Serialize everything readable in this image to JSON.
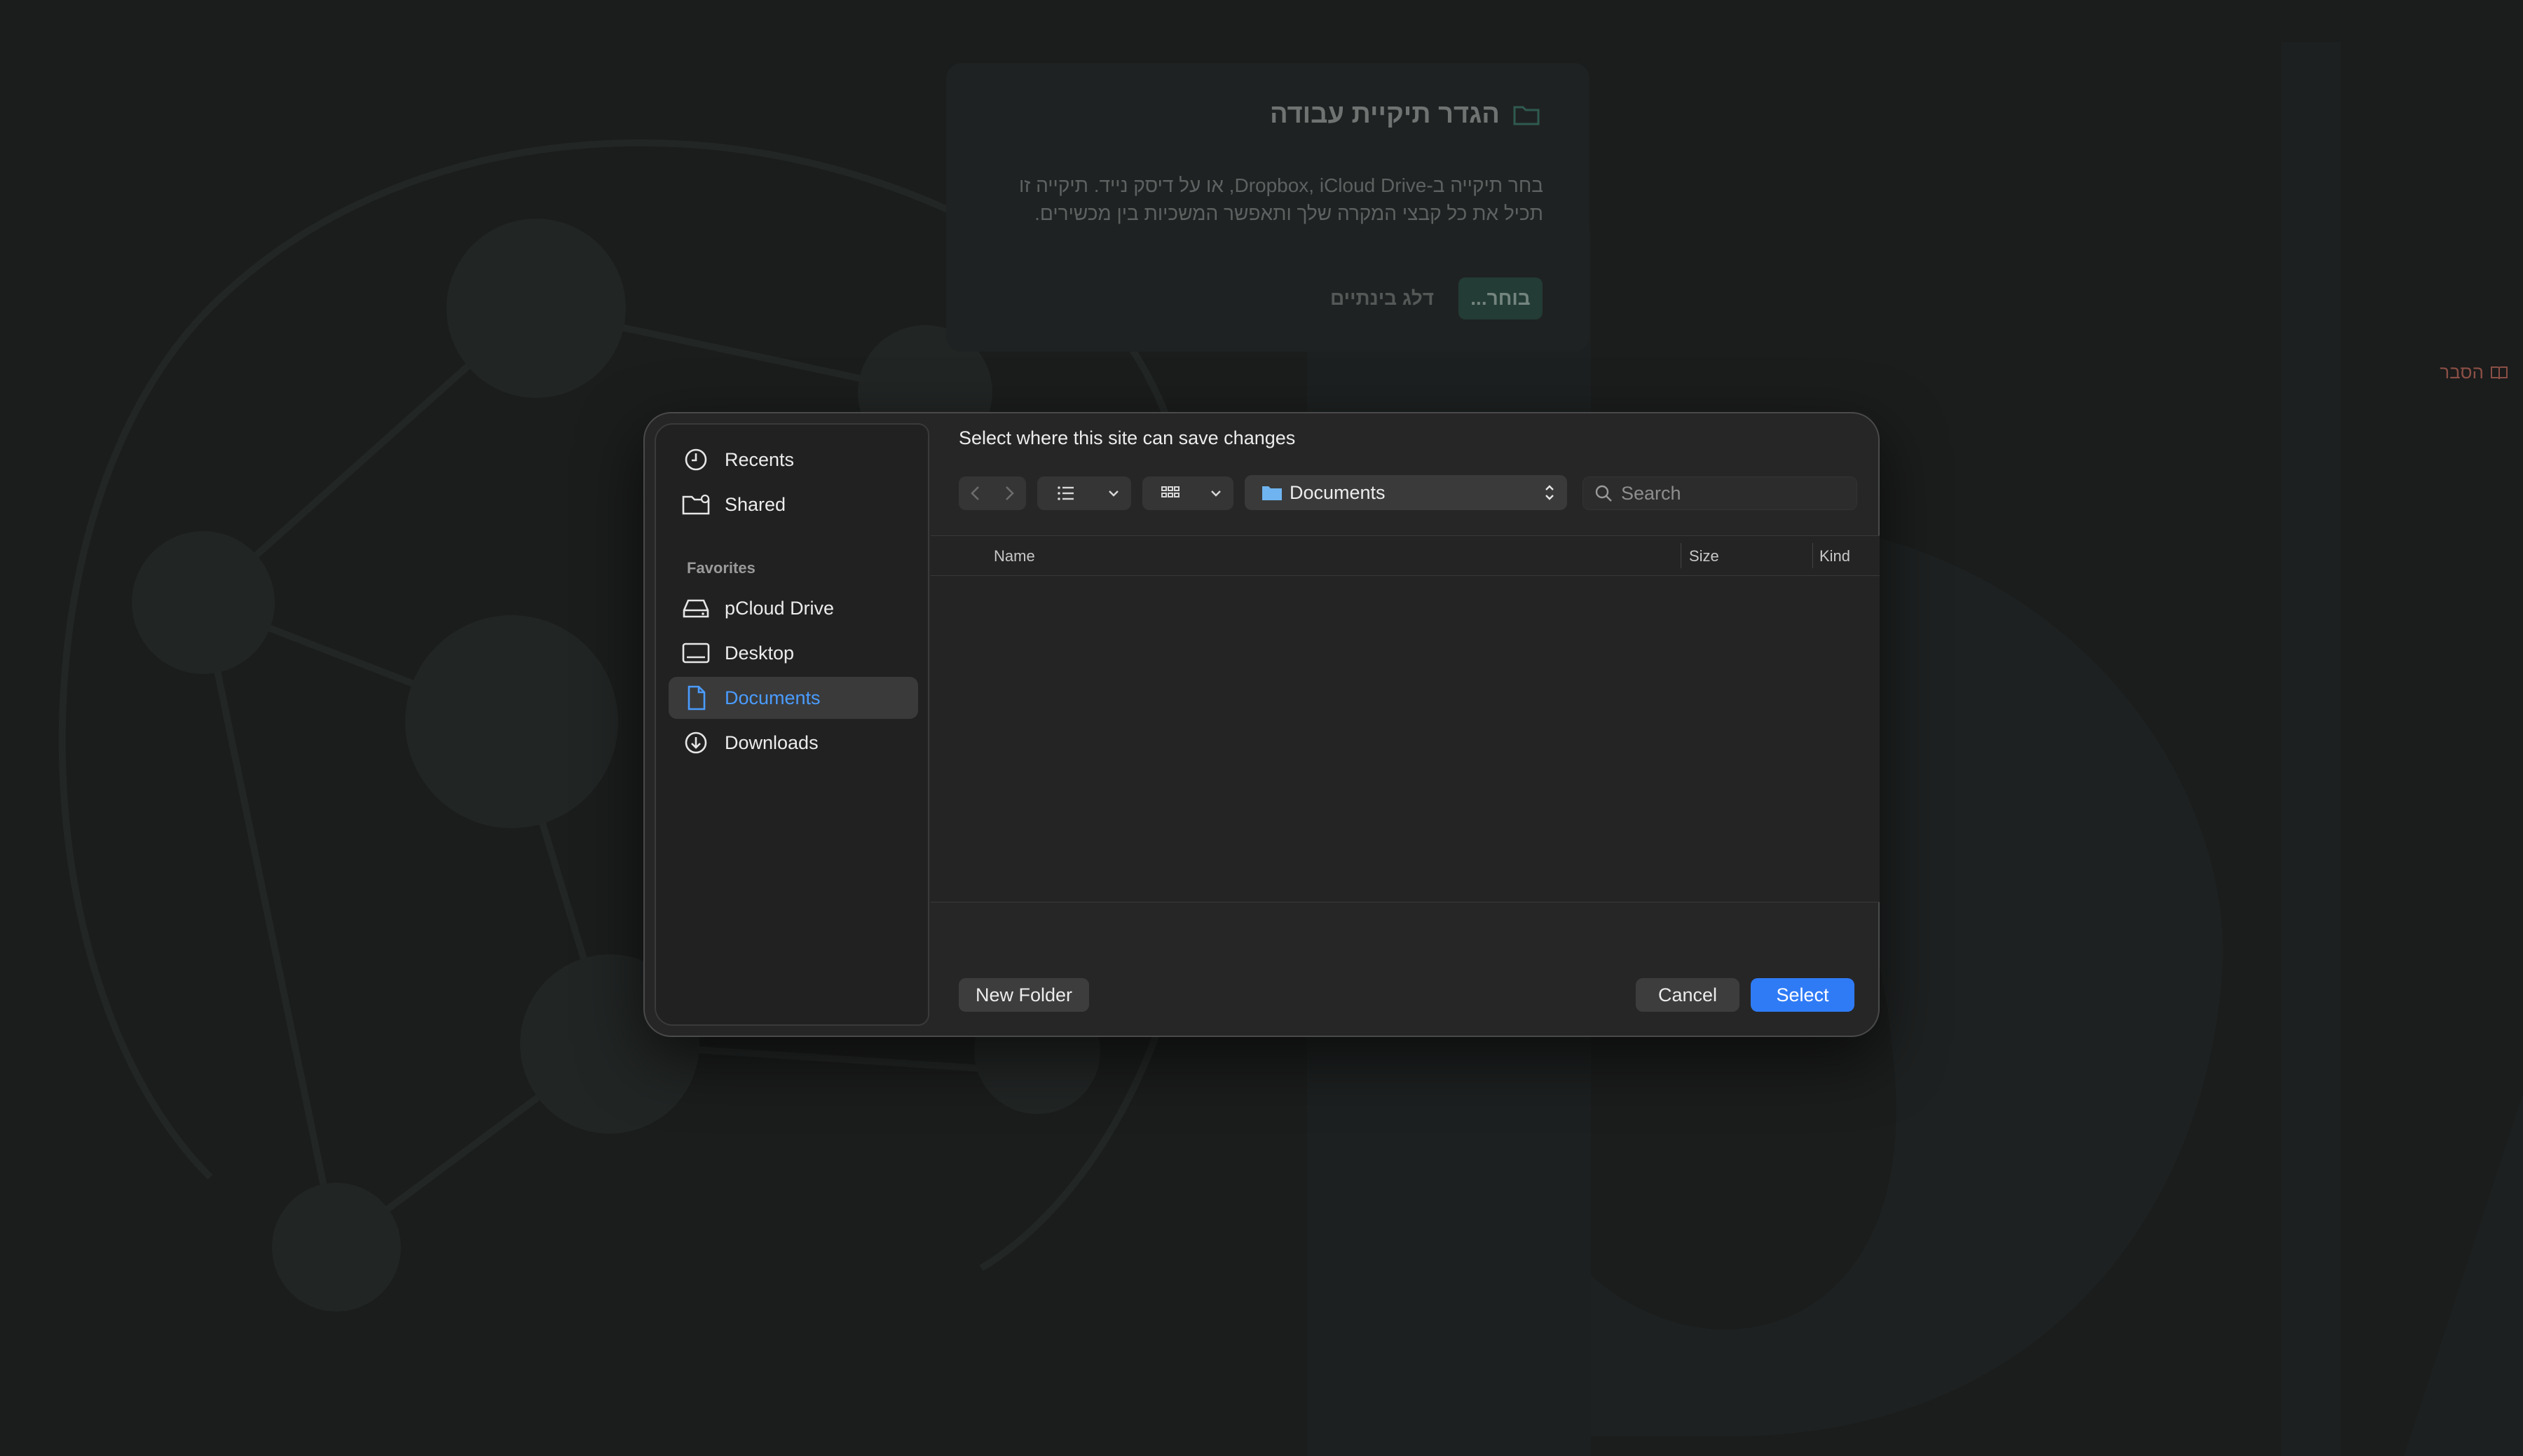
{
  "background": {
    "card": {
      "title": "הגדר תיקיית עבודה",
      "description": "בחר תיקייה ב-Dropbox, iCloud Drive, או על דיסק נייד. תיקייה זו תכיל את כל קבצי המקרה שלך ותאפשר המשכיות בין מכשירים.",
      "choose_label": "בוחר...",
      "skip_label": "דלג בינתיים"
    },
    "side_link": "הסבר"
  },
  "dialog": {
    "title": "Select where this site can save changes",
    "sidebar": {
      "items": [
        {
          "label": "Recents",
          "icon": "clock-icon"
        },
        {
          "label": "Shared",
          "icon": "shared-folder-icon"
        }
      ],
      "section": "Favorites",
      "favorites": [
        {
          "label": "pCloud Drive",
          "icon": "drive-icon"
        },
        {
          "label": "Desktop",
          "icon": "desktop-icon"
        },
        {
          "label": "Documents",
          "icon": "document-icon",
          "active": true
        },
        {
          "label": "Downloads",
          "icon": "download-icon"
        }
      ]
    },
    "location": "Documents",
    "search_placeholder": "Search",
    "columns": {
      "name": "Name",
      "size": "Size",
      "kind": "Kind"
    },
    "buttons": {
      "new_folder": "New Folder",
      "cancel": "Cancel",
      "select": "Select"
    },
    "colors": {
      "accent": "#2f7bf6",
      "active_text": "#4a9cff"
    }
  }
}
